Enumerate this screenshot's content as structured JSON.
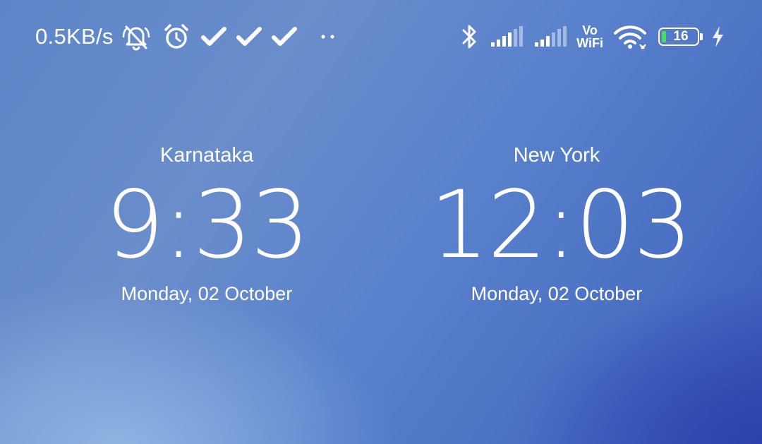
{
  "status_bar": {
    "net_speed": "0.5KB/s",
    "left_icons": [
      "bell-off-icon",
      "alarm-clock-icon",
      "check-icon",
      "check-icon",
      "check-icon",
      "more-dots-icon"
    ],
    "right_icons": [
      "bluetooth-icon",
      "signal-bars-icon",
      "signal-bars-icon",
      "vowifi-icon",
      "wifi-icon",
      "battery-icon",
      "charging-icon"
    ],
    "vowifi_top": "Vo",
    "vowifi_bottom": "WiFi",
    "battery_level": "16",
    "battery_color": "#4cd964"
  },
  "clocks": [
    {
      "city": "Karnataka",
      "time": "9:33",
      "date": "Monday, 02 October"
    },
    {
      "city": "New York",
      "time": "12:03",
      "date": "Monday, 02 October"
    }
  ]
}
